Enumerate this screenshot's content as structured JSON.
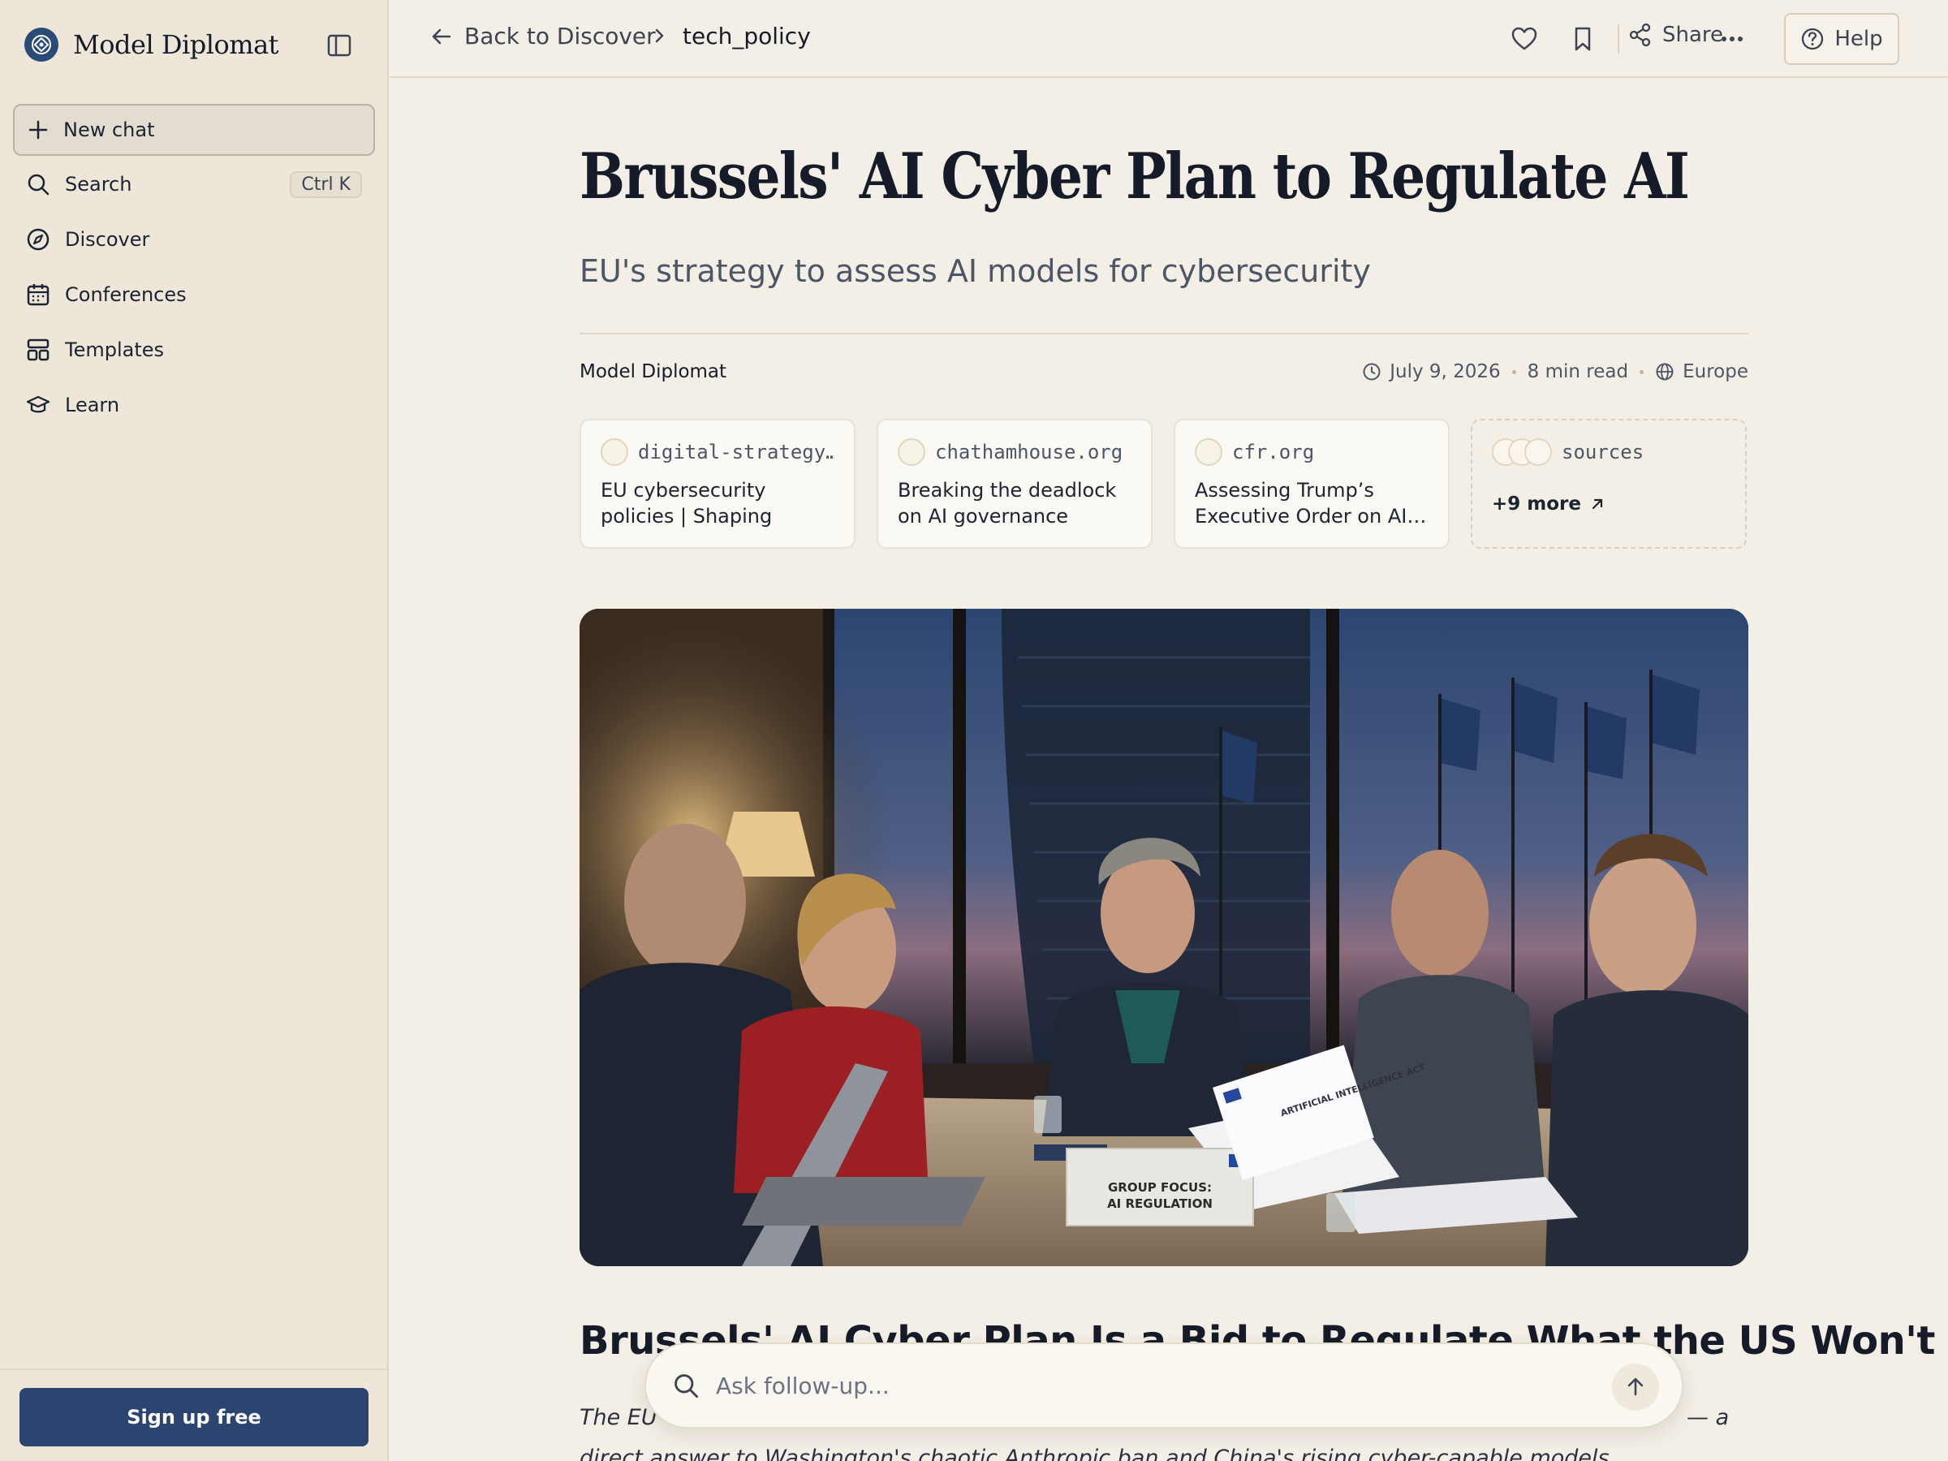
{
  "sidebar": {
    "brand": "Model Diplomat",
    "new_chat": "New chat",
    "search": "Search",
    "search_shortcut": "Ctrl K",
    "items": [
      {
        "label": "Discover",
        "icon": "compass-icon"
      },
      {
        "label": "Conferences",
        "icon": "calendar-icon"
      },
      {
        "label": "Templates",
        "icon": "layout-icon"
      },
      {
        "label": "Learn",
        "icon": "graduation-cap-icon"
      }
    ],
    "signup": "Sign up free"
  },
  "topbar": {
    "back": "Back to Discover",
    "current": "tech_policy",
    "share": "Share",
    "help": "Help"
  },
  "article": {
    "title": "Brussels' AI Cyber Plan to Regulate AI",
    "subtitle": "EU's strategy to assess AI models for cybersecurity",
    "author": "Model Diplomat",
    "date": "July 9, 2026",
    "read_time": "8 min read",
    "region": "Europe",
    "sources": [
      {
        "domain": "digital-strategy…",
        "title": "EU cybersecurity policies | Shaping Europe’s digit…"
      },
      {
        "domain": "chathamhouse.org",
        "title": "Breaking the deadlock on AI governance"
      },
      {
        "domain": "cfr.org",
        "title": "Assessing Trump’s Executive Order on AI…"
      }
    ],
    "sources_label": "sources",
    "more": "+9 more",
    "hero_sign_line1": "GROUP FOCUS:",
    "hero_sign_line2": "AI REGULATION",
    "hero_doc_text": "ARTIFICIAL INTELLIGENCE ACT",
    "heading": "Brussels' AI Cyber Plan Is a Bid to Regulate What the US Won't",
    "para_start": "The EU",
    "para_end": "— a",
    "para_line2": "direct answer to Washington's chaotic Anthropic ban and China's rising cyber-capable models."
  },
  "followup": {
    "placeholder": "Ask follow-up..."
  },
  "colors": {
    "accent": "#2b4470",
    "background": "#f4efe6",
    "sidebar": "#ede6d9"
  }
}
